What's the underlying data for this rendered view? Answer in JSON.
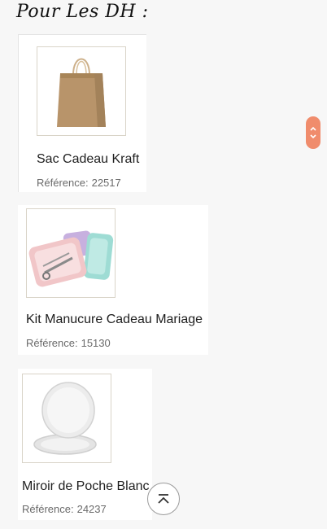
{
  "section": {
    "title": "Pour Les DH :"
  },
  "products": [
    {
      "name": "Sac Cadeau Kraft",
      "ref_label": "Référence:",
      "ref_value": "22517",
      "image_icon": "kraft-bag-icon"
    },
    {
      "name": "Kit Manucure Cadeau Mariage",
      "ref_label": "Référence:",
      "ref_value": "15130",
      "image_icon": "manicure-kit-icon"
    },
    {
      "name": "Miroir de Poche Blanc",
      "ref_label": "Référence:",
      "ref_value": "24237",
      "image_icon": "pocket-mirror-icon"
    }
  ],
  "controls": {
    "scroll_toggle_icon": "chevron-up-down-icon",
    "back_to_top_icon": "chevron-up-bar-icon"
  },
  "colors": {
    "accent": "#f08c6c",
    "kraft": "#b8946a"
  }
}
